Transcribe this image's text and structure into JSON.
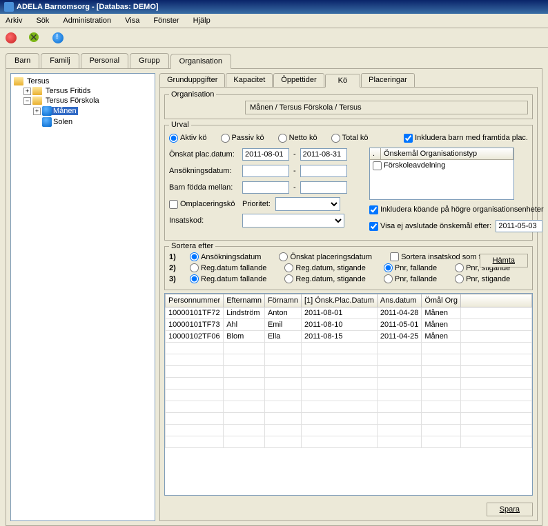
{
  "title": "ADELA Barnomsorg - [Databas: DEMO]",
  "menu": [
    "Arkiv",
    "Sök",
    "Administration",
    "Visa",
    "Fönster",
    "Hjälp"
  ],
  "mainTabs": {
    "items": [
      "Barn",
      "Familj",
      "Personal",
      "Grupp",
      "Organisation"
    ],
    "active": 4
  },
  "tree": {
    "root": "Tersus",
    "n1": "Tersus Fritids",
    "n2": "Tersus Förskola",
    "n2a": "Månen",
    "n2b": "Solen"
  },
  "subTabs": {
    "items": [
      "Grunduppgifter",
      "Kapacitet",
      "Öppettider",
      "Kö",
      "Placeringar"
    ],
    "active": 3
  },
  "org": {
    "legend": "Organisation",
    "path": "Månen / Tersus Förskola / Tersus"
  },
  "urval": {
    "legend": "Urval",
    "radios": {
      "aktiv": "Aktiv kö",
      "passiv": "Passiv kö",
      "netto": "Netto kö",
      "total": "Total kö"
    },
    "includeFuture": "Inkludera barn med framtida plac.",
    "labels": {
      "onskat": "Önskat plac.datum:",
      "ansok": "Ansökningsdatum:",
      "fodda": "Barn födda mellan:",
      "omplac": "Omplaceringskö",
      "prioritet": "Prioritet:",
      "insatskod": "Insatskod:"
    },
    "date1": "2011-08-01",
    "date2": "2011-08-31",
    "dash": "-",
    "orgtypHeader": "Önskemål Organisationstyp",
    "dot": ".",
    "orgtypRow": "Förskoleavdelning",
    "includeHigher": "Inkludera köande på högre organisationsenheter",
    "showUnfinished": "Visa ej avslutade önskemål efter:",
    "unfinishedDate": "2011-05-03"
  },
  "sort": {
    "legend": "Sortera efter",
    "r1": {
      "a": "Ansökningsdatum",
      "b": "Önskat placeringsdatum",
      "c": "Sortera insatskod som förtur"
    },
    "r2": {
      "a": "Reg.datum fallande",
      "b": "Reg.datum, stigande",
      "c": "Pnr, fallande",
      "d": "Pnr, stigande"
    },
    "r3": {
      "a": "Reg.datum fallande",
      "b": "Reg.datum, stigande",
      "c": "Pnr, fallande",
      "d": "Pnr, stigande"
    },
    "nums": {
      "n1": "1)",
      "n2": "2)",
      "n3": "3)"
    }
  },
  "buttons": {
    "hamta": "Hämta",
    "spara": "Spara"
  },
  "table": {
    "headers": [
      "Personnummer",
      "Efternamn",
      "Förnamn",
      "[1] Önsk.Plac.Datum",
      "Ans.datum",
      "Ömål Org"
    ],
    "rows": [
      [
        "10000101TF72",
        "Lindström",
        "Anton",
        "2011-08-01",
        "2011-04-28",
        "Månen"
      ],
      [
        "10000101TF73",
        "Ahl",
        "Emil",
        "2011-08-10",
        "2011-05-01",
        "Månen"
      ],
      [
        "10000102TF06",
        "Blom",
        "Ella",
        "2011-08-15",
        "2011-04-25",
        "Månen"
      ]
    ]
  }
}
